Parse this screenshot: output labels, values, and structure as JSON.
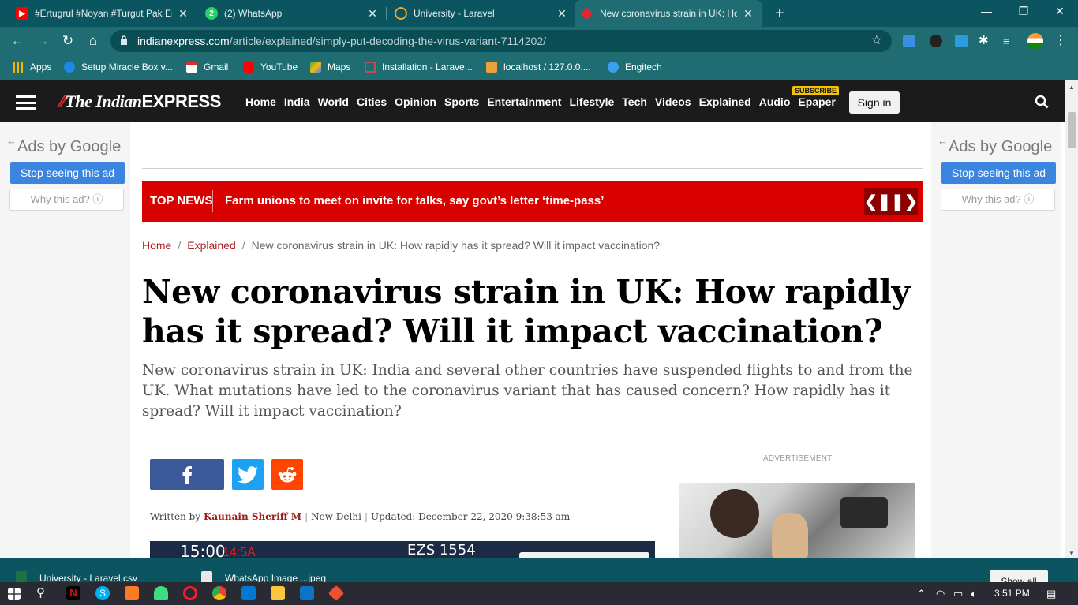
{
  "browser": {
    "tabs": [
      {
        "title": "#Ertugrul #Noyan #Turgut Pak Er",
        "icon": "youtube-icon",
        "color": "#ff0000"
      },
      {
        "title": "(2) WhatsApp",
        "icon": "whatsapp-icon",
        "color": "#25d366"
      },
      {
        "title": "University - Laravel",
        "icon": "laravel-icon",
        "color": "#f5a623"
      },
      {
        "title": "New coronavirus strain in UK: Ho",
        "icon": "indianexpress-icon",
        "color": "#e3262d",
        "active": true
      }
    ],
    "new_tab_label": "+",
    "window_controls": {
      "minimize": "—",
      "restore": "❐",
      "close": "✕"
    },
    "url_domain": "indianexpress.com",
    "url_path": "/article/explained/simply-put-decoding-the-virus-variant-7114202/",
    "bookmarks": [
      "Apps",
      "Setup Miracle Box v...",
      "Gmail",
      "YouTube",
      "Maps",
      "Installation - Larave...",
      "localhost / 127.0.0....",
      "Engitech"
    ]
  },
  "site": {
    "logo_part1": "The Indian",
    "logo_part2": "EXPRESS",
    "menu": [
      "Home",
      "India",
      "World",
      "Cities",
      "Opinion",
      "Sports",
      "Entertainment",
      "Lifestyle",
      "Tech",
      "Videos",
      "Explained",
      "Audio",
      "Epaper"
    ],
    "subscribe_badge": "SUBSCRIBE",
    "signin_label": "Sign in"
  },
  "ads": {
    "ads_by": "Ads by",
    "google": "Google",
    "stop_label": "Stop seeing this ad",
    "why_label": "Why this ad? ⓘ",
    "advertisement_label": "ADVERTISEMENT"
  },
  "topnews": {
    "label": "TOP NEWS",
    "headline": "Farm unions to meet on invite for talks, say govt’s letter ‘time-pass’"
  },
  "breadcrumb": {
    "home": "Home",
    "section": "Explained",
    "current": "New coronavirus strain in UK: How rapidly has it spread? Will it impact vaccination?"
  },
  "article": {
    "headline": "New coronavirus strain in UK: How rapidly has it spread? Will it impact vaccination?",
    "synopsis": "New coronavirus strain in UK: India and several other countries have suspended flights to and from the UK. What mutations have led to the coronavirus variant that has caused concern? How rapidly has it spread? Will it impact vaccination?",
    "written_by": "Written by",
    "author": "Kaunain Sheriff M",
    "location": "New Delhi",
    "updated": "Updated: December 22, 2020 9:38:53 am",
    "photo_text1": "15:00",
    "photo_text2": "14:5A",
    "photo_text3": "EZS 1554"
  },
  "downloads": {
    "items": [
      "University - Laravel.csv",
      "WhatsApp Image ...jpeg"
    ],
    "show_all": "Show all"
  },
  "taskbar": {
    "time": "3:51 PM"
  }
}
